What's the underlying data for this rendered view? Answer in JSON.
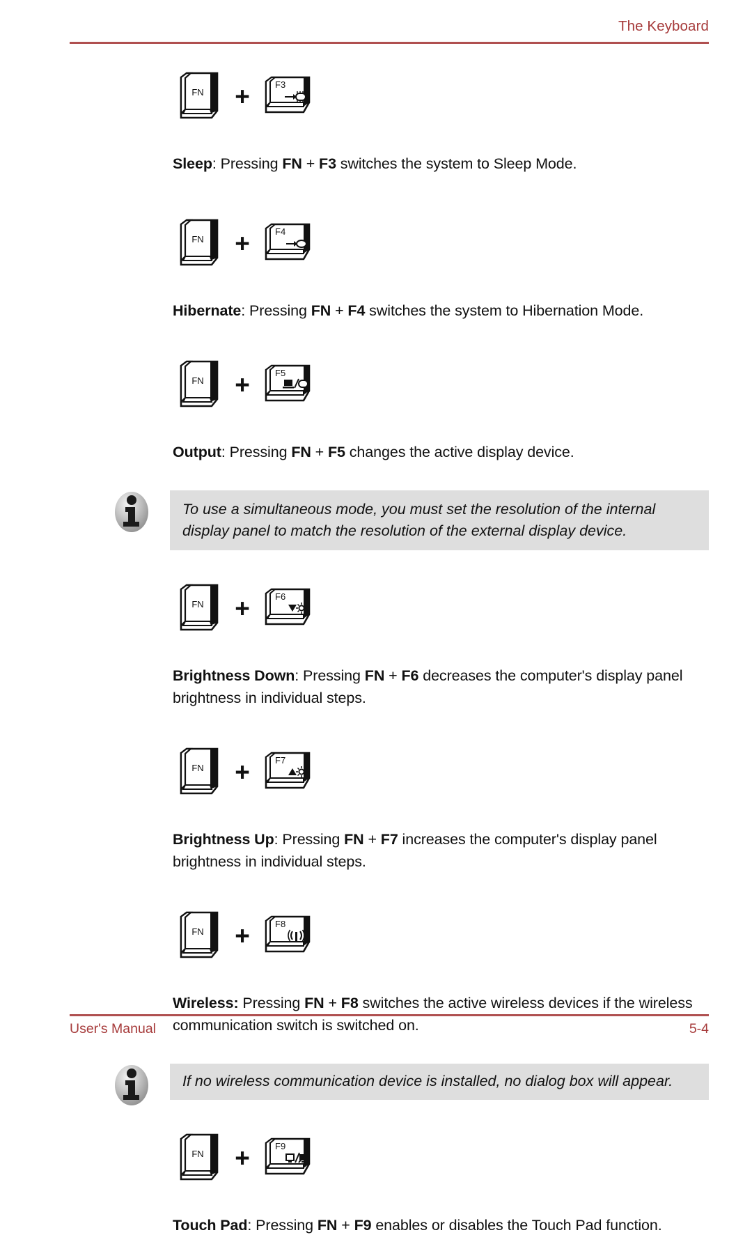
{
  "header": {
    "title": "The Keyboard",
    "rule_color": "#b05050",
    "text_color": "#a63a3a"
  },
  "footer": {
    "left_label": "User's Manual",
    "page_number": "5-4",
    "rule_color": "#b05050",
    "text_color": "#a63a3a"
  },
  "shortcuts": [
    {
      "modifier_key_label": "FN",
      "plus": "+",
      "function_key_label": "F3",
      "function_key_icon": "sleep-icon",
      "title": "Sleep",
      "separator": ":",
      "body_before": " Pressing ",
      "combo_modifier": "FN",
      "combo_plus": " + ",
      "combo_function": "F3",
      "body_after": " switches the system to Sleep Mode."
    },
    {
      "modifier_key_label": "FN",
      "plus": "+",
      "function_key_label": "F4",
      "function_key_icon": "hibernate-icon",
      "title": "Hibernate",
      "separator": ":",
      "body_before": " Pressing ",
      "combo_modifier": "FN",
      "combo_plus": " + ",
      "combo_function": "F4",
      "body_after": " switches the system to Hibernation Mode."
    },
    {
      "modifier_key_label": "FN",
      "plus": "+",
      "function_key_label": "F5",
      "function_key_icon": "display-output-icon",
      "title": "Output",
      "separator": ":",
      "body_before": " Pressing ",
      "combo_modifier": "FN",
      "combo_plus": " + ",
      "combo_function": "F5",
      "body_after": " changes the active display device."
    },
    {
      "modifier_key_label": "FN",
      "plus": "+",
      "function_key_label": "F6",
      "function_key_icon": "brightness-down-icon",
      "title": "Brightness Down",
      "separator": ":",
      "body_before": " Pressing ",
      "combo_modifier": "FN",
      "combo_plus": " + ",
      "combo_function": "F6",
      "body_after": " decreases the computer's display panel brightness in individual steps."
    },
    {
      "modifier_key_label": "FN",
      "plus": "+",
      "function_key_label": "F7",
      "function_key_icon": "brightness-up-icon",
      "title": "Brightness Up",
      "separator": ":",
      "body_before": " Pressing ",
      "combo_modifier": "FN",
      "combo_plus": " + ",
      "combo_function": "F7",
      "body_after": " increases the computer's display panel brightness in individual steps."
    },
    {
      "modifier_key_label": "FN",
      "plus": "+",
      "function_key_label": "F8",
      "function_key_icon": "wireless-antenna-icon",
      "title": "Wireless:",
      "separator": "",
      "body_before": " Pressing ",
      "combo_modifier": "FN",
      "combo_plus": " + ",
      "combo_function": "F8",
      "body_after": " switches the active wireless devices if the wireless communication switch is switched on."
    },
    {
      "modifier_key_label": "FN",
      "plus": "+",
      "function_key_label": "F9",
      "function_key_icon": "touchpad-icon",
      "title": "Touch Pad",
      "separator": ":",
      "body_before": " Pressing ",
      "combo_modifier": "FN",
      "combo_plus": " + ",
      "combo_function": "F9",
      "body_after": " enables or disables the Touch Pad function."
    }
  ],
  "notes": [
    {
      "icon": "info-icon",
      "text": "To use a simultaneous mode, you must set the resolution of the internal display panel to match the resolution of the external display device.",
      "background": "#dedede"
    },
    {
      "icon": "info-icon",
      "text": "If no wireless communication device is installed, no dialog box will appear.",
      "background": "#dedede"
    }
  ]
}
